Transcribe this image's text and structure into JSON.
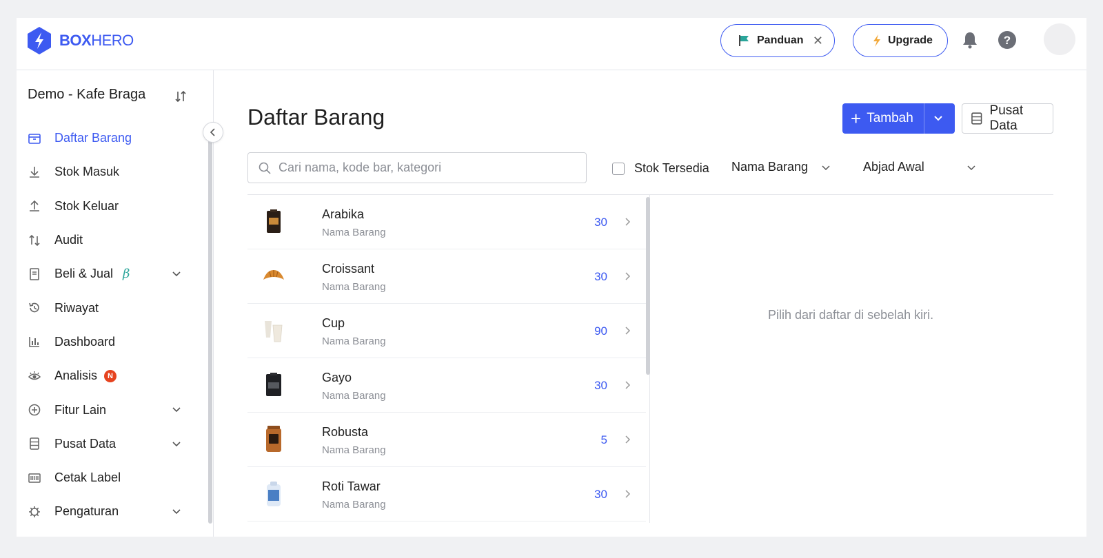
{
  "brand": {
    "name_bold": "BOX",
    "name_light": "HERO",
    "accent": "#3d5af1"
  },
  "topbar": {
    "guide_label": "Panduan",
    "guide_close": "✕",
    "upgrade_label": "Upgrade"
  },
  "sidebar": {
    "store_name": "Demo - Kafe Braga",
    "items": [
      {
        "label": "Daftar Barang",
        "icon": "box-icon",
        "active": true
      },
      {
        "label": "Stok Masuk",
        "icon": "download-icon"
      },
      {
        "label": "Stok Keluar",
        "icon": "upload-icon"
      },
      {
        "label": "Audit",
        "icon": "swap-icon"
      },
      {
        "label": "Beli & Jual",
        "icon": "document-icon",
        "beta": "β",
        "expandable": true
      },
      {
        "label": "Riwayat",
        "icon": "history-icon"
      },
      {
        "label": "Dashboard",
        "icon": "bar-chart-icon"
      },
      {
        "label": "Analisis",
        "icon": "eye-icon",
        "badge": "N"
      },
      {
        "label": "Fitur Lain",
        "icon": "plus-circle-icon",
        "expandable": true
      },
      {
        "label": "Pusat Data",
        "icon": "database-icon",
        "expandable": true
      },
      {
        "label": "Cetak Label",
        "icon": "barcode-icon"
      },
      {
        "label": "Pengaturan",
        "icon": "gear-icon",
        "expandable": true
      }
    ]
  },
  "main": {
    "title": "Daftar Barang",
    "add_label": "Tambah",
    "data_center_label": "Pusat Data",
    "search_placeholder": "Cari nama, kode bar, kategori",
    "stock_filter_label": "Stok Tersedia",
    "sort_field": "Nama Barang",
    "sort_order": "Abjad Awal",
    "empty_detail": "Pilih dari daftar di sebelah kiri."
  },
  "items": [
    {
      "name": "Arabika",
      "sub": "Nama Barang",
      "qty": "30",
      "thumb": "coffee-bag-dark"
    },
    {
      "name": "Croissant",
      "sub": "Nama Barang",
      "qty": "30",
      "thumb": "croissant"
    },
    {
      "name": "Cup",
      "sub": "Nama Barang",
      "qty": "90",
      "thumb": "paper-cup"
    },
    {
      "name": "Gayo",
      "sub": "Nama Barang",
      "qty": "30",
      "thumb": "coffee-bag-black"
    },
    {
      "name": "Robusta",
      "sub": "Nama Barang",
      "qty": "5",
      "thumb": "coffee-bag-copper"
    },
    {
      "name": "Roti Tawar",
      "sub": "Nama Barang",
      "qty": "30",
      "thumb": "bread-bag"
    }
  ]
}
